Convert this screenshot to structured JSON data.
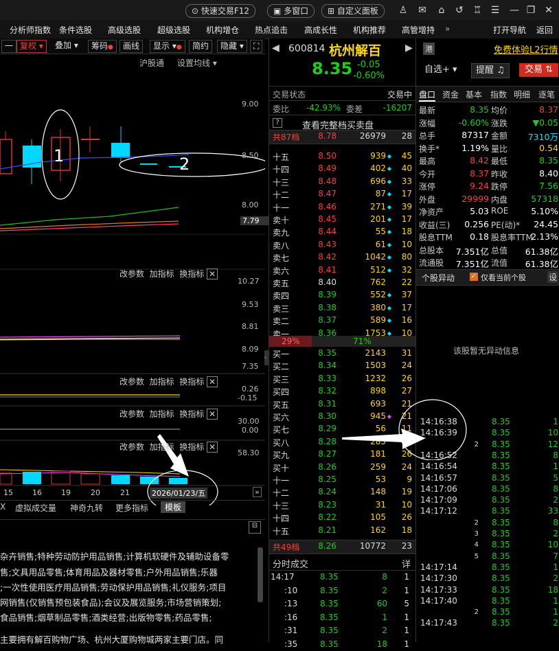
{
  "topbar": {
    "quick_trade": "快速交易F12",
    "multi_window": "多窗口",
    "custom_panel": "自定义面板",
    "icons": [
      "user-icon",
      "mail-icon",
      "home-icon",
      "back-icon",
      "shirt-icon",
      "menu-icon",
      "minimize-icon",
      "restore-icon",
      "close-icon"
    ]
  },
  "menu": [
    "分析师指数",
    "条件选股",
    "高级选股",
    "超级选股",
    "机构增仓",
    "热点追击",
    "高成长性",
    "机构推荐",
    "高管增持",
    "»",
    "打开导航",
    "返回"
  ],
  "chart_toolbar": {
    "items": [
      "一",
      "复权",
      "叠加",
      "筹码",
      "画线",
      "显示",
      "简约",
      "隐藏"
    ],
    "row2": [
      "沪股通",
      "设置均线"
    ]
  },
  "chart_axis": {
    "main": [
      "9.00",
      "8.50",
      "8.00",
      "7.79"
    ],
    "ind1": [
      "10.27",
      "9.53",
      "8.81",
      "8.09",
      "7.35"
    ],
    "ind2": [
      "0.26",
      "-0.15"
    ],
    "ind3": [
      "30.00",
      "0.00"
    ],
    "ind4": [
      "58.30"
    ]
  },
  "panel_tools": {
    "change_params": "改参数",
    "add_indicator": "加指标",
    "switch_indicator": "换指标"
  },
  "annotations": {
    "label1": "1",
    "label2": "2"
  },
  "date_axis": {
    "labels": [
      "15",
      "16",
      "19",
      "20",
      "21"
    ],
    "current": "2026/01/23/五"
  },
  "bottom_tabs": [
    "X",
    "虚拟成交量",
    "神奇九转",
    "更多指标",
    "模板"
  ],
  "description": [
    "杂卉销售;特种劳动防护用品销售;计算机软硬件及辅助设备零",
    "售;文具用品零售;体育用品及器材零售;户外用品销售;乐器",
    ";一次性使用医疗用品销售;劳动保护用品销售;礼仪服务;项目",
    "网销售(仅销售预包装食品);会议及展览服务;市场营销策划;",
    "食品销售;烟草制品零售;酒类经营;出版物零售;药品零售;",
    "",
    "主要拥有解百购物广场、杭州大厦购物城两家主要门店。同"
  ],
  "stock": {
    "code": "600814",
    "name": "杭州解百",
    "tag": "港",
    "price": "8.35",
    "change": "-0.05",
    "change_pct": "-0.60%",
    "l2_link": "免费体验L2行情",
    "watch_btn": "自选+",
    "alert_btn": "提醒",
    "trade_btn": "交易"
  },
  "trade_status": {
    "label": "交易状态",
    "value": "交易中"
  },
  "ratio": {
    "wb_label": "委比",
    "wb": "-42.93%",
    "wc_label": "委差",
    "wc": "-16207"
  },
  "full_book": "查看完整档买卖盘",
  "book_totals": {
    "sell_label": "共87档",
    "sell_price": "8.78",
    "sell_vol": "26979",
    "sell_cnt": "28",
    "buy_label": "共49档",
    "buy_price": "8.26",
    "buy_vol": "10772",
    "buy_cnt": "23"
  },
  "asks": [
    {
      "label": "十五",
      "price": "8.50",
      "vol": "939",
      "cnt": "45",
      "dot": "cyan"
    },
    {
      "label": "十四",
      "price": "8.49",
      "vol": "402",
      "cnt": "40",
      "dot": "cyan"
    },
    {
      "label": "十三",
      "price": "8.48",
      "vol": "696",
      "cnt": "33",
      "dot": "cyan"
    },
    {
      "label": "十二",
      "price": "8.47",
      "vol": "87",
      "cnt": "17",
      "dot": "cyan"
    },
    {
      "label": "十一",
      "price": "8.46",
      "vol": "271",
      "cnt": "39",
      "dot": "cyan"
    },
    {
      "label": "卖十",
      "price": "8.45",
      "vol": "201",
      "cnt": "17",
      "dot": "cyan"
    },
    {
      "label": "卖九",
      "price": "8.44",
      "vol": "55",
      "cnt": "18",
      "dot": "cyan"
    },
    {
      "label": "卖八",
      "price": "8.43",
      "vol": "61",
      "cnt": "10",
      "dot": "cyan"
    },
    {
      "label": "卖七",
      "price": "8.42",
      "vol": "1042",
      "cnt": "80",
      "dot": "cyan"
    },
    {
      "label": "卖六",
      "price": "8.41",
      "vol": "512",
      "cnt": "32",
      "dot": "cyan"
    },
    {
      "label": "卖五",
      "price": "8.40",
      "vol": "762",
      "cnt": "22",
      "dot": ""
    },
    {
      "label": "卖四",
      "price": "8.39",
      "vol": "552",
      "cnt": "37",
      "dot": "cyan"
    },
    {
      "label": "卖三",
      "price": "8.38",
      "vol": "380",
      "cnt": "17",
      "dot": "cyan"
    },
    {
      "label": "卖二",
      "price": "8.37",
      "vol": "589",
      "cnt": "16",
      "dot": "cyan"
    },
    {
      "label": "卖一",
      "price": "8.36",
      "vol": "1753",
      "cnt": "10",
      "dot": "cyan"
    }
  ],
  "ratio_bar": {
    "left": "29%",
    "right": "71%",
    "left_frac": 0.29
  },
  "bids": [
    {
      "label": "买一",
      "price": "8.35",
      "vol": "2143",
      "cnt": "31",
      "dot": ""
    },
    {
      "label": "买二",
      "price": "8.34",
      "vol": "1503",
      "cnt": "24",
      "dot": ""
    },
    {
      "label": "买三",
      "price": "8.33",
      "vol": "1232",
      "cnt": "26",
      "dot": ""
    },
    {
      "label": "买四",
      "price": "8.32",
      "vol": "898",
      "cnt": "27",
      "dot": ""
    },
    {
      "label": "买五",
      "price": "8.31",
      "vol": "693",
      "cnt": "21",
      "dot": ""
    },
    {
      "label": "买六",
      "price": "8.30",
      "vol": "945",
      "cnt": "21",
      "dot": "magenta"
    },
    {
      "label": "买七",
      "price": "8.29",
      "vol": "56",
      "cnt": "11",
      "dot": ""
    },
    {
      "label": "买八",
      "price": "8.28",
      "vol": "285",
      "cnt": "17",
      "dot": ""
    },
    {
      "label": "买九",
      "price": "8.27",
      "vol": "181",
      "cnt": "26",
      "dot": ""
    },
    {
      "label": "买十",
      "price": "8.26",
      "vol": "259",
      "cnt": "24",
      "dot": ""
    },
    {
      "label": "十一",
      "price": "8.25",
      "vol": "53",
      "cnt": "9",
      "dot": ""
    },
    {
      "label": "十二",
      "price": "8.24",
      "vol": "148",
      "cnt": "19",
      "dot": ""
    },
    {
      "label": "十三",
      "price": "8.23",
      "vol": "31",
      "cnt": "10",
      "dot": ""
    },
    {
      "label": "十四",
      "price": "8.22",
      "vol": "105",
      "cnt": "26",
      "dot": ""
    },
    {
      "label": "十五",
      "price": "8.21",
      "vol": "162",
      "cnt": "18",
      "dot": ""
    }
  ],
  "ticks_header": {
    "label": "分时成交",
    "detail": "详"
  },
  "ticks": [
    {
      "time": "14:17",
      "price": "8.35",
      "vol": "8",
      "n": "1"
    },
    {
      "time": ":10",
      "price": "8.35",
      "vol": "2",
      "n": "1"
    },
    {
      "time": ":13",
      "price": "8.35",
      "vol": "60",
      "n": "5"
    },
    {
      "time": ":16",
      "price": "8.35",
      "vol": "1",
      "n": "1"
    },
    {
      "time": ":31",
      "price": "8.35",
      "vol": "2",
      "n": "1"
    },
    {
      "time": ":35",
      "price": "8.35",
      "vol": "18",
      "n": "1"
    }
  ],
  "tabs_right": [
    "盘口",
    "资金",
    "基本",
    "指数",
    "明细",
    "逐笔"
  ],
  "quote": [
    {
      "l1": "最新",
      "v1": "8.35",
      "c1": "green",
      "l2": "均价",
      "v2": "8.37",
      "c2": "red"
    },
    {
      "l1": "涨幅",
      "v1": "-0.60%",
      "c1": "green",
      "l2": "涨跌",
      "v2": "▼0.05",
      "c2": "green"
    },
    {
      "l1": "总手",
      "v1": "87317",
      "c1": "white",
      "l2": "金额",
      "v2": "7310万",
      "c2": "cyan"
    },
    {
      "l1": "换手*",
      "v1": "1.19%",
      "c1": "white",
      "l2": "量比",
      "v2": "0.54",
      "c2": "yellow"
    },
    {
      "l1": "最高",
      "v1": "8.42",
      "c1": "red",
      "l2": "最低",
      "v2": "8.35",
      "c2": "green"
    },
    {
      "l1": "今开",
      "v1": "8.37",
      "c1": "red",
      "l2": "昨收",
      "v2": "8.40",
      "c2": "white"
    },
    {
      "l1": "涨停",
      "v1": "9.24",
      "c1": "red",
      "l2": "跌停",
      "v2": "7.56",
      "c2": "green"
    },
    {
      "l1": "外盘",
      "v1": "29999",
      "c1": "red",
      "l2": "内盘",
      "v2": "57318",
      "c2": "green"
    },
    {
      "l1": "净资产",
      "v1": "5.03",
      "c1": "white",
      "l2": "ROE",
      "v2": "5.10%",
      "c2": "white"
    },
    {
      "l1": "收益(三)",
      "v1": "0.256",
      "c1": "white",
      "l2": "PE(动)*",
      "v2": "24.45",
      "c2": "white"
    },
    {
      "l1": "股息TTM",
      "v1": "0.18",
      "c1": "white",
      "l2": "股息率TTM",
      "v2": "2.13%",
      "c2": "white"
    },
    {
      "l1": "总股本",
      "v1": "7.351亿",
      "c1": "white",
      "l2": "总值",
      "v2": "61.38亿",
      "c2": "white"
    },
    {
      "l1": "流通股",
      "v1": "7.351亿",
      "c1": "white",
      "l2": "流值",
      "v2": "61.38亿",
      "c2": "white"
    }
  ],
  "anomaly": {
    "title": "个股异动",
    "only_current": "仅看当前个股",
    "settings": "设",
    "empty": "该股暂无异动信息"
  },
  "trades_right": [
    {
      "time": "14:16:38",
      "price": "8.35",
      "vol": "1"
    },
    {
      "time": "14:16:39",
      "price": "8.35",
      "vol": "10"
    },
    {
      "time": "2",
      "price": "8.35",
      "vol": "12"
    },
    {
      "time": "14:16:52",
      "price": "8.35",
      "vol": "8"
    },
    {
      "time": "14:16:54",
      "price": "8.35",
      "vol": "1"
    },
    {
      "time": "14:16:57",
      "price": "8.35",
      "vol": "5"
    },
    {
      "time": "14:17:06",
      "price": "8.35",
      "vol": "8"
    },
    {
      "time": "14:17:09",
      "price": "8.35",
      "vol": "2"
    },
    {
      "time": "14:17:12",
      "price": "8.35",
      "vol": "33"
    },
    {
      "time": "2",
      "price": "8.35",
      "vol": "8"
    },
    {
      "time": "3",
      "price": "8.35",
      "vol": "2"
    },
    {
      "time": "4",
      "price": "8.35",
      "vol": "10"
    },
    {
      "time": "5",
      "price": "8.35",
      "vol": "7"
    },
    {
      "time": "14:17:14",
      "price": "8.35",
      "vol": "1"
    },
    {
      "time": "14:17:30",
      "price": "8.35",
      "vol": "2"
    },
    {
      "time": "14:17:33",
      "price": "8.35",
      "vol": "18"
    },
    {
      "time": "14:17:40",
      "price": "8.35",
      "vol": "1"
    },
    {
      "time": "2",
      "price": "8.35",
      "vol": "1"
    },
    {
      "time": "14:17:43",
      "price": "8.35",
      "vol": "2"
    }
  ]
}
